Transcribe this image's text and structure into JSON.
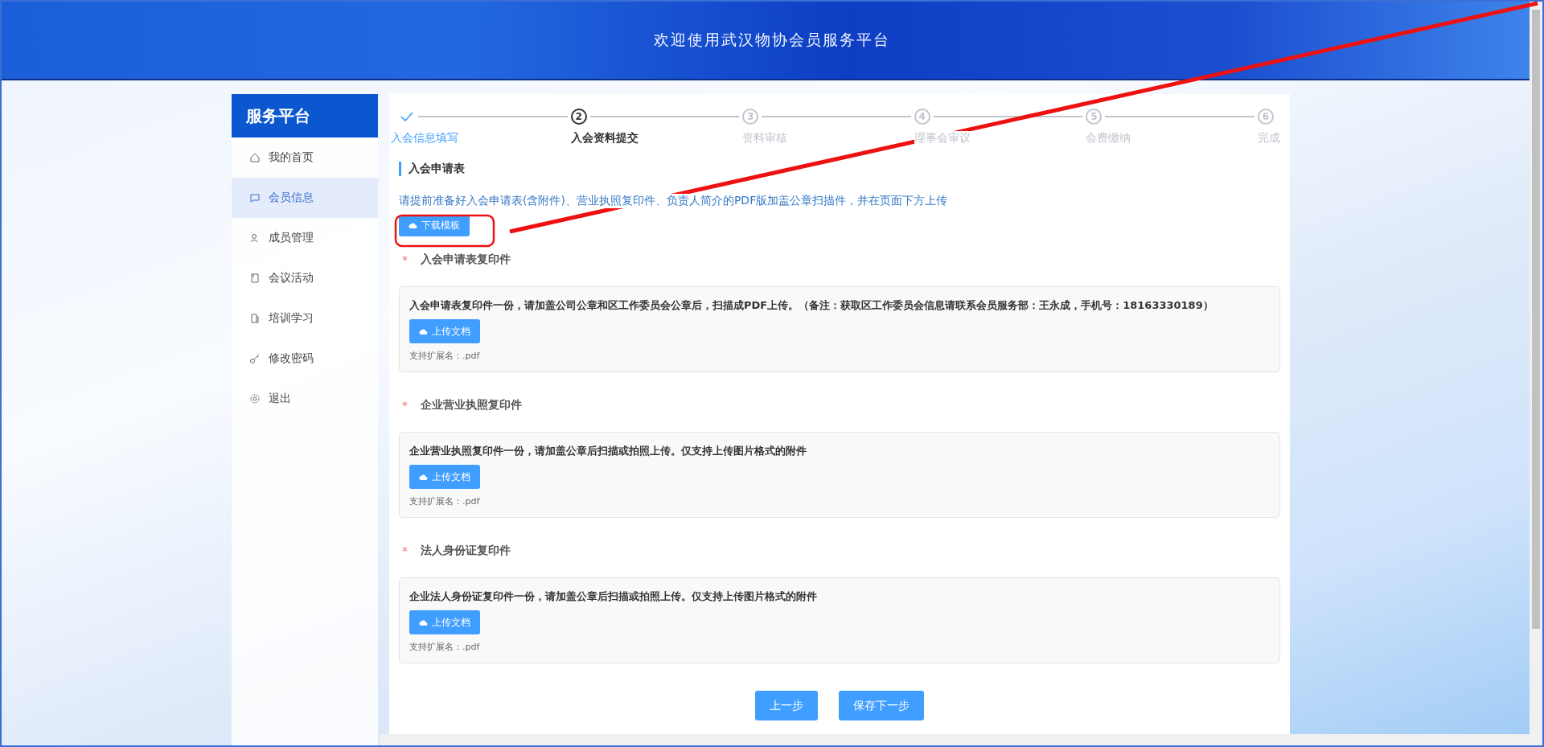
{
  "header": {
    "title": "欢迎使用武汉物协会员服务平台"
  },
  "sidebar": {
    "title": "服务平台",
    "items": [
      {
        "label": "我的首页",
        "selected": false
      },
      {
        "label": "会员信息",
        "selected": true
      },
      {
        "label": "成员管理",
        "selected": false
      },
      {
        "label": "会议活动",
        "selected": false
      },
      {
        "label": "培训学习",
        "selected": false
      },
      {
        "label": "修改密码",
        "selected": false
      },
      {
        "label": "退出",
        "selected": false
      }
    ]
  },
  "steps": [
    {
      "title": "入会信息填写",
      "done": true,
      "selected": false
    },
    {
      "number": "2",
      "title": "入会资料提交",
      "done": false,
      "selected": true
    },
    {
      "number": "3",
      "title": "资料审核",
      "done": false,
      "selected": false
    },
    {
      "number": "4",
      "title": "理事会审议",
      "done": false,
      "selected": false
    },
    {
      "number": "5",
      "title": "会费缴纳",
      "done": false,
      "selected": false
    },
    {
      "number": "6",
      "title": "完成",
      "done": false,
      "selected": false
    }
  ],
  "section_title": "入会申请表",
  "hint": "请提前准备好入会申请表(含附件)、营业执照复印件、负责人简介的PDF版加盖公章扫描件，并在页面下方上传",
  "download_button": "下载模板",
  "uploads": [
    {
      "label": "入会申请表复印件",
      "required_mark": "*",
      "description": "入会申请表复印件一份，请加盖公司公章和区工作委员会公章后，扫描成PDF上传。（备注：获取区工作委员会信息请联系会员服务部：王永成，手机号：18163330189）",
      "button": "上传文档",
      "extensions": "支持扩展名：.pdf"
    },
    {
      "label": "企业营业执照复印件",
      "required_mark": "*",
      "description": "企业营业执照复印件一份，请加盖公章后扫描或拍照上传。仅支持上传图片格式的附件",
      "button": "上传文档",
      "extensions": "支持扩展名：.pdf"
    },
    {
      "label": "法人身份证复印件",
      "required_mark": "*",
      "description": "企业法人身份证复印件一份，请加盖公章后扫描或拍照上传。仅支持上传图片格式的附件",
      "button": "上传文档",
      "extensions": "支持扩展名：.pdf"
    }
  ],
  "actions": [
    "上一步",
    "保存下一步"
  ]
}
